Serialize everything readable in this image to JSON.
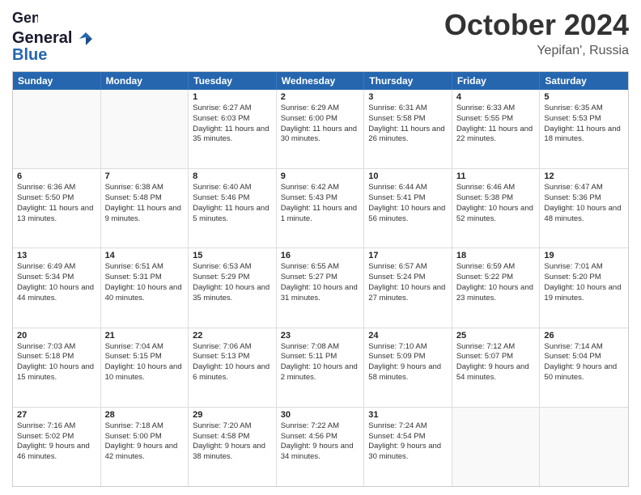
{
  "header": {
    "logo_general": "General",
    "logo_blue": "Blue",
    "title": "October 2024",
    "location": "Yepifan', Russia"
  },
  "days_of_week": [
    "Sunday",
    "Monday",
    "Tuesday",
    "Wednesday",
    "Thursday",
    "Friday",
    "Saturday"
  ],
  "weeks": [
    [
      {
        "day": "",
        "text": ""
      },
      {
        "day": "",
        "text": ""
      },
      {
        "day": "1",
        "text": "Sunrise: 6:27 AM\nSunset: 6:03 PM\nDaylight: 11 hours and 35 minutes."
      },
      {
        "day": "2",
        "text": "Sunrise: 6:29 AM\nSunset: 6:00 PM\nDaylight: 11 hours and 30 minutes."
      },
      {
        "day": "3",
        "text": "Sunrise: 6:31 AM\nSunset: 5:58 PM\nDaylight: 11 hours and 26 minutes."
      },
      {
        "day": "4",
        "text": "Sunrise: 6:33 AM\nSunset: 5:55 PM\nDaylight: 11 hours and 22 minutes."
      },
      {
        "day": "5",
        "text": "Sunrise: 6:35 AM\nSunset: 5:53 PM\nDaylight: 11 hours and 18 minutes."
      }
    ],
    [
      {
        "day": "6",
        "text": "Sunrise: 6:36 AM\nSunset: 5:50 PM\nDaylight: 11 hours and 13 minutes."
      },
      {
        "day": "7",
        "text": "Sunrise: 6:38 AM\nSunset: 5:48 PM\nDaylight: 11 hours and 9 minutes."
      },
      {
        "day": "8",
        "text": "Sunrise: 6:40 AM\nSunset: 5:46 PM\nDaylight: 11 hours and 5 minutes."
      },
      {
        "day": "9",
        "text": "Sunrise: 6:42 AM\nSunset: 5:43 PM\nDaylight: 11 hours and 1 minute."
      },
      {
        "day": "10",
        "text": "Sunrise: 6:44 AM\nSunset: 5:41 PM\nDaylight: 10 hours and 56 minutes."
      },
      {
        "day": "11",
        "text": "Sunrise: 6:46 AM\nSunset: 5:38 PM\nDaylight: 10 hours and 52 minutes."
      },
      {
        "day": "12",
        "text": "Sunrise: 6:47 AM\nSunset: 5:36 PM\nDaylight: 10 hours and 48 minutes."
      }
    ],
    [
      {
        "day": "13",
        "text": "Sunrise: 6:49 AM\nSunset: 5:34 PM\nDaylight: 10 hours and 44 minutes."
      },
      {
        "day": "14",
        "text": "Sunrise: 6:51 AM\nSunset: 5:31 PM\nDaylight: 10 hours and 40 minutes."
      },
      {
        "day": "15",
        "text": "Sunrise: 6:53 AM\nSunset: 5:29 PM\nDaylight: 10 hours and 35 minutes."
      },
      {
        "day": "16",
        "text": "Sunrise: 6:55 AM\nSunset: 5:27 PM\nDaylight: 10 hours and 31 minutes."
      },
      {
        "day": "17",
        "text": "Sunrise: 6:57 AM\nSunset: 5:24 PM\nDaylight: 10 hours and 27 minutes."
      },
      {
        "day": "18",
        "text": "Sunrise: 6:59 AM\nSunset: 5:22 PM\nDaylight: 10 hours and 23 minutes."
      },
      {
        "day": "19",
        "text": "Sunrise: 7:01 AM\nSunset: 5:20 PM\nDaylight: 10 hours and 19 minutes."
      }
    ],
    [
      {
        "day": "20",
        "text": "Sunrise: 7:03 AM\nSunset: 5:18 PM\nDaylight: 10 hours and 15 minutes."
      },
      {
        "day": "21",
        "text": "Sunrise: 7:04 AM\nSunset: 5:15 PM\nDaylight: 10 hours and 10 minutes."
      },
      {
        "day": "22",
        "text": "Sunrise: 7:06 AM\nSunset: 5:13 PM\nDaylight: 10 hours and 6 minutes."
      },
      {
        "day": "23",
        "text": "Sunrise: 7:08 AM\nSunset: 5:11 PM\nDaylight: 10 hours and 2 minutes."
      },
      {
        "day": "24",
        "text": "Sunrise: 7:10 AM\nSunset: 5:09 PM\nDaylight: 9 hours and 58 minutes."
      },
      {
        "day": "25",
        "text": "Sunrise: 7:12 AM\nSunset: 5:07 PM\nDaylight: 9 hours and 54 minutes."
      },
      {
        "day": "26",
        "text": "Sunrise: 7:14 AM\nSunset: 5:04 PM\nDaylight: 9 hours and 50 minutes."
      }
    ],
    [
      {
        "day": "27",
        "text": "Sunrise: 7:16 AM\nSunset: 5:02 PM\nDaylight: 9 hours and 46 minutes."
      },
      {
        "day": "28",
        "text": "Sunrise: 7:18 AM\nSunset: 5:00 PM\nDaylight: 9 hours and 42 minutes."
      },
      {
        "day": "29",
        "text": "Sunrise: 7:20 AM\nSunset: 4:58 PM\nDaylight: 9 hours and 38 minutes."
      },
      {
        "day": "30",
        "text": "Sunrise: 7:22 AM\nSunset: 4:56 PM\nDaylight: 9 hours and 34 minutes."
      },
      {
        "day": "31",
        "text": "Sunrise: 7:24 AM\nSunset: 4:54 PM\nDaylight: 9 hours and 30 minutes."
      },
      {
        "day": "",
        "text": ""
      },
      {
        "day": "",
        "text": ""
      }
    ]
  ]
}
